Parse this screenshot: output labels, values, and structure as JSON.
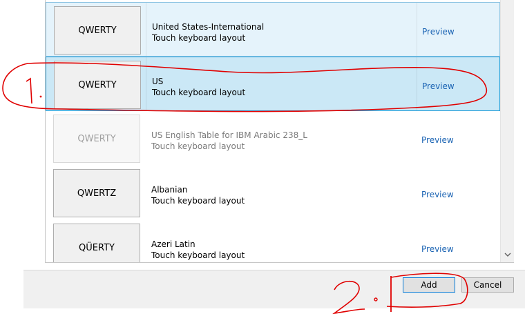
{
  "layouts": [
    {
      "tile_label": "QWERTY",
      "name": "United States-International",
      "type": "Touch keyboard layout",
      "preview_label": "Preview",
      "state": "highlight",
      "enabled": true
    },
    {
      "tile_label": "QWERTY",
      "name": "US",
      "type": "Touch keyboard layout",
      "preview_label": "Preview",
      "state": "selected",
      "enabled": true
    },
    {
      "tile_label": "QWERTY",
      "name": "US English Table for IBM Arabic 238_L",
      "type": "Touch keyboard layout",
      "preview_label": "Preview",
      "state": "normal",
      "enabled": false
    },
    {
      "tile_label": "QWERTZ",
      "name": "Albanian",
      "type": "Touch keyboard layout",
      "preview_label": "Preview",
      "state": "normal",
      "enabled": true
    },
    {
      "tile_label": "QÜERTY",
      "name": "Azeri Latin",
      "type": "Touch keyboard layout",
      "preview_label": "Preview",
      "state": "normal",
      "enabled": true
    }
  ],
  "footer": {
    "add_label": "Add",
    "cancel_label": "Cancel"
  },
  "annotations": {
    "step1": "1.",
    "step2": "2."
  },
  "icons": {
    "scroll_down": "chevron-down-icon"
  },
  "colors": {
    "highlight_bg": "#e5f3fb",
    "selected_bg": "#cbe8f6",
    "link": "#1a63b3",
    "annotation": "#e00000"
  }
}
